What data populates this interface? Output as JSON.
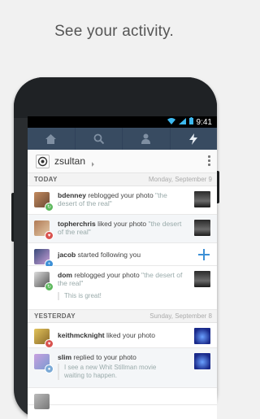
{
  "headline": "See your activity.",
  "status_bar": {
    "time": "9:41"
  },
  "nav": {
    "tabs": [
      {
        "name": "home"
      },
      {
        "name": "search"
      },
      {
        "name": "account"
      },
      {
        "name": "activity"
      }
    ]
  },
  "account": {
    "username": "zsultan"
  },
  "sections": {
    "today": {
      "label": "TODAY",
      "date": "Monday, September 9"
    },
    "yesterday": {
      "label": "YESTERDAY",
      "date": "Sunday, September 8"
    }
  },
  "activity": [
    {
      "user": "bdenney",
      "action": "reblogged your photo",
      "quote": "\"the desert of the real\""
    },
    {
      "user": "topherchris",
      "action": "liked your photo",
      "quote": "\"the desert of the real\""
    },
    {
      "user": "jacob",
      "action": "started following you"
    },
    {
      "user": "dom",
      "action": "reblogged your photo",
      "quote": "\"the desert of the real\"",
      "reply": "This is great!"
    },
    {
      "user": "keithmcknight",
      "action": "liked your photo"
    },
    {
      "user": "slim",
      "action": "replied to your photo",
      "reply": "I see a new Whit Stillman movie waiting to happen."
    }
  ],
  "colors": {
    "nav_bg": "#384b61",
    "follow_plus": "#3d90d6",
    "like_badge": "#d9534f",
    "reblog_badge": "#5cb85c",
    "follow_badge": "#3d90d6",
    "reply_badge": "#7aa9d6"
  }
}
